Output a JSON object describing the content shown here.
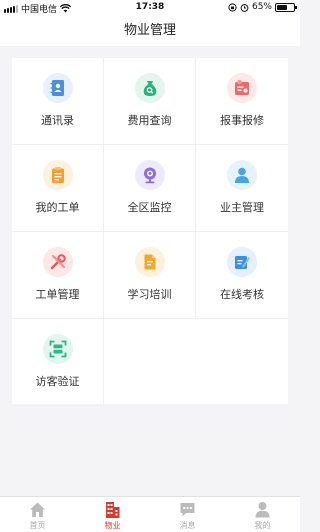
{
  "status_bar": {
    "carrier": "中国电信",
    "time": "17:38",
    "battery_percent": "65%",
    "battery_level": 0.65
  },
  "header": {
    "title": "物业管理"
  },
  "grid": {
    "items": [
      {
        "label": "通讯录",
        "icon": "contacts-icon",
        "color": "#4a90d9",
        "bg": "#e8f1fb"
      },
      {
        "label": "费用查询",
        "icon": "money-bag-icon",
        "color": "#2bb07e",
        "bg": "#e3f6ee"
      },
      {
        "label": "报事报修",
        "icon": "repair-report-icon",
        "color": "#ee6a6a",
        "bg": "#fde9e9"
      },
      {
        "label": "我的工单",
        "icon": "clipboard-icon",
        "color": "#f0a030",
        "bg": "#fdf1df"
      },
      {
        "label": "全区监控",
        "icon": "camera-icon",
        "color": "#8a6fd6",
        "bg": "#efeafb"
      },
      {
        "label": "业主管理",
        "icon": "user-icon",
        "color": "#49a4e3",
        "bg": "#e6f3fc"
      },
      {
        "label": "工单管理",
        "icon": "tools-icon",
        "color": "#e35a5a",
        "bg": "#fde8e8"
      },
      {
        "label": "学习培训",
        "icon": "document-icon",
        "color": "#f2a72e",
        "bg": "#fdf1de"
      },
      {
        "label": "在线考核",
        "icon": "edit-icon",
        "color": "#3d8fe0",
        "bg": "#e5f0fc"
      },
      {
        "label": "访客验证",
        "icon": "scan-icon",
        "color": "#2fb58a",
        "bg": "#e2f6ef"
      }
    ]
  },
  "tabbar": {
    "accent": "#d93a2e",
    "inactive": "#bbbbbb",
    "tabs": [
      {
        "label": "首页",
        "icon": "home-icon",
        "active": false
      },
      {
        "label": "物业",
        "icon": "building-icon",
        "active": true
      },
      {
        "label": "消息",
        "icon": "message-icon",
        "active": false
      },
      {
        "label": "我的",
        "icon": "profile-icon",
        "active": false
      }
    ]
  }
}
